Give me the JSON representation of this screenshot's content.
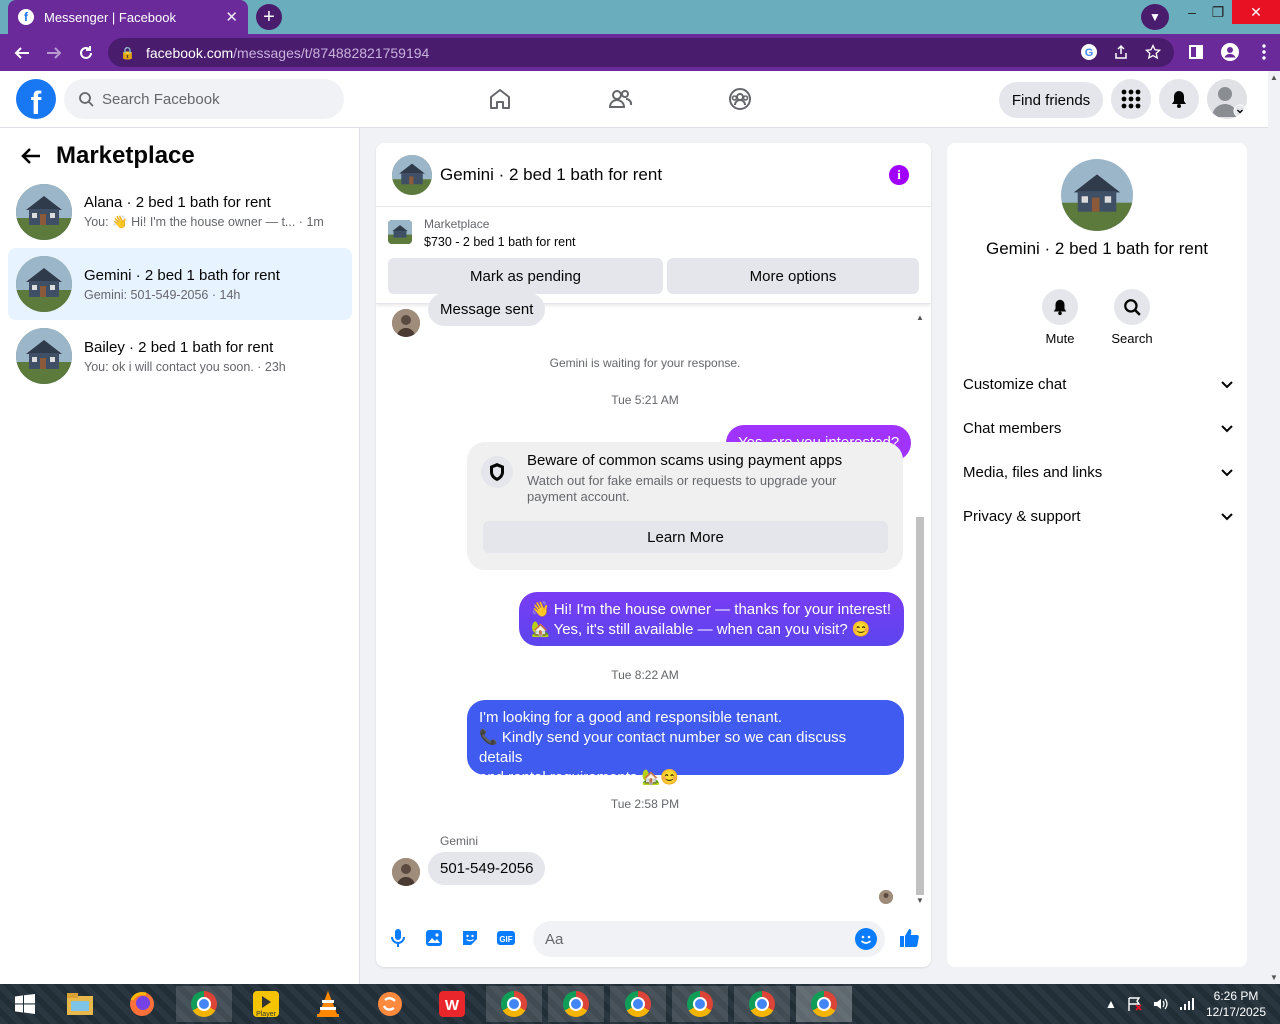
{
  "browser": {
    "tab_title": "Messenger | Facebook",
    "url_host": "facebook.com",
    "url_path": "/messages/t/874882821759194"
  },
  "header": {
    "search_placeholder": "Search Facebook",
    "find_friends": "Find friends"
  },
  "sidebar": {
    "title": "Marketplace",
    "conversations": [
      {
        "name": "Alana · 2 bed 1 bath for rent",
        "snippet": "You: 👋 Hi! I'm the house owner — t... · 1m"
      },
      {
        "name": "Gemini · 2 bed 1 bath for rent",
        "snippet": "Gemini: 501-549-2056 · 14h"
      },
      {
        "name": "Bailey · 2 bed 1 bath for rent",
        "snippet": "You: ok i will contact you soon. · 23h"
      }
    ]
  },
  "chat": {
    "title": "Gemini · 2 bed 1 bath for rent",
    "marketplace_label": "Marketplace",
    "listing": "$730 - 2 bed 1 bath for rent",
    "mark_pending": "Mark as pending",
    "more_options": "More options",
    "msg_sent": "Message sent",
    "waiting": "Gemini is waiting for your response.",
    "time1": "Tue 5:21 AM",
    "out1": "Yes, are you interested?",
    "warn_title": "Beware of common scams using payment apps",
    "warn_desc": "Watch out for fake emails or requests to upgrade your payment account.",
    "learn_more": "Learn More",
    "out2_line1": "👋 Hi! I'm the house owner — thanks for your interest!",
    "out2_line2": "🏡 Yes, it's still available — when can you visit? 😊",
    "time2": "Tue 8:22 AM",
    "out3_line1": "I'm looking for a good and responsible tenant.",
    "out3_line2": "📞 Kindly send your contact number so we can discuss details",
    "out3_line3": "and rental requirements 🏡😊",
    "time3": "Tue 2:58 PM",
    "sender": "Gemini",
    "in_phone": "501-549-2056",
    "composer_placeholder": "Aa"
  },
  "details": {
    "name": "Gemini · 2 bed 1 bath for rent",
    "mute": "Mute",
    "search": "Search",
    "sections": [
      "Customize chat",
      "Chat members",
      "Media, files and links",
      "Privacy & support"
    ]
  },
  "taskbar": {
    "time": "6:26 PM",
    "date": "12/17/2025"
  },
  "colors": {
    "fb_blue": "#1877f2",
    "msg_purple": "#a033ff",
    "msg_blue": "#3f5bf0",
    "chrome_purple": "#6a2a9a"
  }
}
